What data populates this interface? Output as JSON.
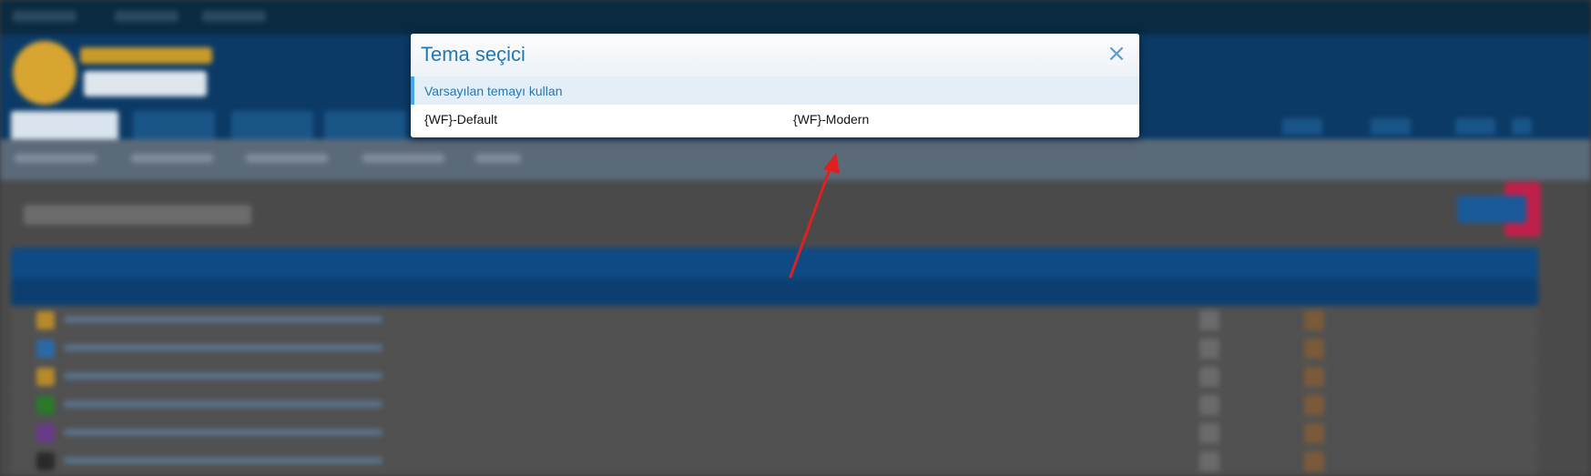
{
  "modal": {
    "title": "Tema seçici",
    "close_glyph": "×",
    "default_option": "Varsayılan temayı kullan",
    "styles": [
      "{WF}-Default",
      "{WF}-Modern"
    ]
  },
  "colors": {
    "modal_title": "#2577b1",
    "default_row_bg": "#e3eef7",
    "default_row_border": "#47a7eb",
    "annotation_arrow": "#e02020"
  },
  "icons": [
    "close-icon",
    "annotation-arrow"
  ]
}
